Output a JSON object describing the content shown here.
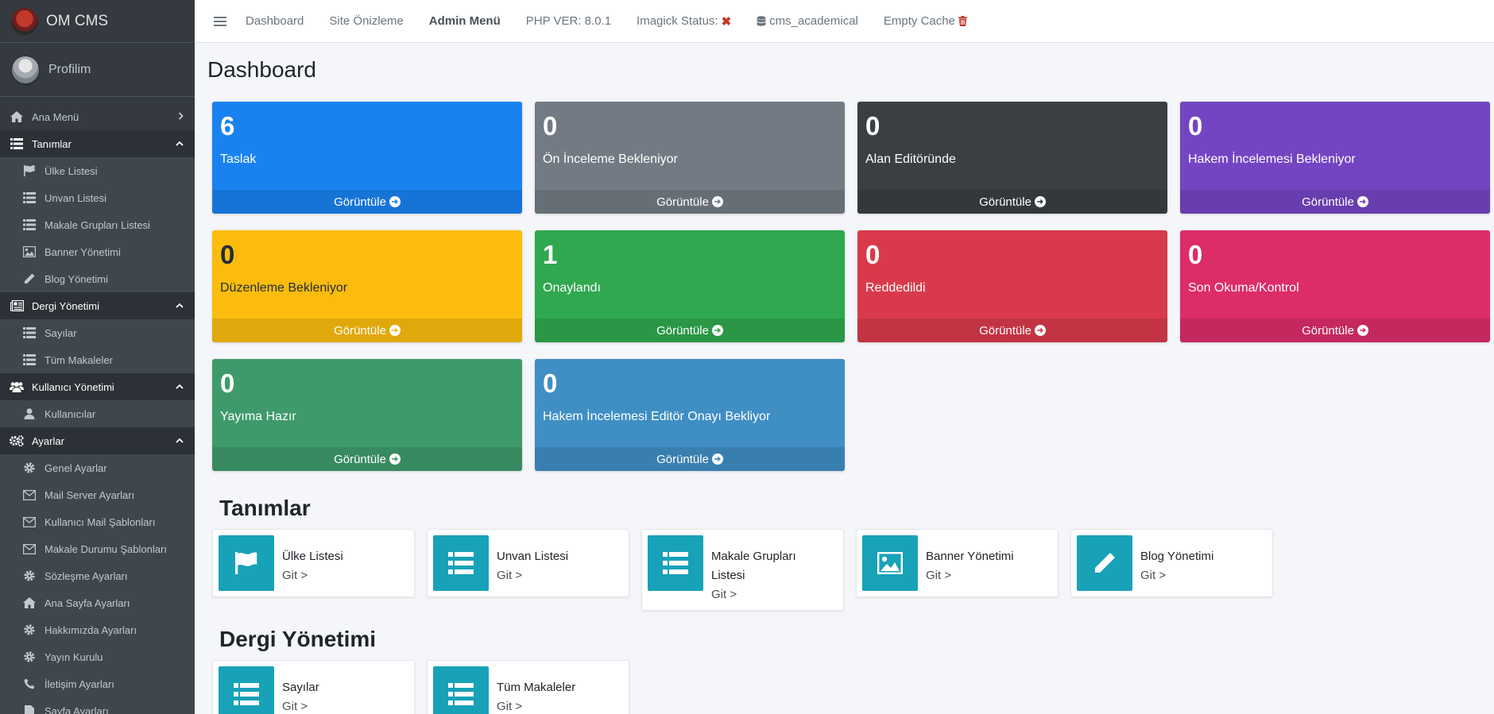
{
  "brand": {
    "name": "OM CMS"
  },
  "user": {
    "name": "Profilim"
  },
  "sidebar": {
    "items": [
      {
        "label": "Ana Menü",
        "icon": "home-icon",
        "type": "plain",
        "chevron": "›"
      },
      {
        "label": "Tanımlar",
        "icon": "list-icon",
        "type": "head",
        "chevron": "‹"
      },
      {
        "label": "Ülke Listesi",
        "icon": "flag-icon",
        "type": "sub"
      },
      {
        "label": "Unvan Listesi",
        "icon": "list-icon",
        "type": "sub"
      },
      {
        "label": "Makale Grupları Listesi",
        "icon": "list-icon",
        "type": "sub"
      },
      {
        "label": "Banner Yönetimi",
        "icon": "image-icon",
        "type": "sub"
      },
      {
        "label": "Blog Yönetimi",
        "icon": "pencil-icon",
        "type": "sub"
      },
      {
        "label": "Dergi Yönetimi",
        "icon": "newspaper-icon",
        "type": "head",
        "chevron": "‹"
      },
      {
        "label": "Sayılar",
        "icon": "list-icon",
        "type": "sub"
      },
      {
        "label": "Tüm Makaleler",
        "icon": "list-icon",
        "type": "sub"
      },
      {
        "label": "Kullanıcı Yönetimi",
        "icon": "users-icon",
        "type": "head",
        "chevron": "‹"
      },
      {
        "label": "Kullanıcılar",
        "icon": "user-icon",
        "type": "sub"
      },
      {
        "label": "Ayarlar",
        "icon": "gears-icon",
        "type": "head",
        "chevron": "‹"
      },
      {
        "label": "Genel Ayarlar",
        "icon": "gear-icon",
        "type": "sub"
      },
      {
        "label": "Mail Server Ayarları",
        "icon": "envelope-icon",
        "type": "sub"
      },
      {
        "label": "Kullanıcı Mail Şablonları",
        "icon": "envelope-icon",
        "type": "sub"
      },
      {
        "label": "Makale Durumu Şablonları",
        "icon": "envelope-icon",
        "type": "sub"
      },
      {
        "label": "Sözleşme Ayarları",
        "icon": "gear-icon",
        "type": "sub"
      },
      {
        "label": "Ana Sayfa Ayarları",
        "icon": "home-icon",
        "type": "sub"
      },
      {
        "label": "Hakkımızda Ayarları",
        "icon": "gear-icon",
        "type": "sub"
      },
      {
        "label": "Yayın Kurulu",
        "icon": "gear-icon",
        "type": "sub"
      },
      {
        "label": "İletişim Ayarları",
        "icon": "phone-icon",
        "type": "sub"
      },
      {
        "label": "Sayfa Ayarları",
        "icon": "file-icon",
        "type": "sub"
      }
    ]
  },
  "topbar": {
    "dashboard": "Dashboard",
    "preview": "Site Önizleme",
    "admin_menu": "Admin Menü",
    "php_ver": "PHP VER: 8.0.1",
    "imagick": "Imagick Status:",
    "imagick_mark": "✖",
    "db": "cms_academical",
    "cache": "Empty Cache"
  },
  "page": {
    "title": "Dashboard"
  },
  "stats": [
    {
      "value": "6",
      "label": "Taslak",
      "link": "Görüntüle",
      "color": "#1a82f0"
    },
    {
      "value": "0",
      "label": "Ön İnceleme Bekleniyor",
      "link": "Görüntüle",
      "color": "#727b84"
    },
    {
      "value": "0",
      "label": "Alan Editöründe",
      "link": "Görüntüle",
      "color": "#3a3f44"
    },
    {
      "value": "0",
      "label": "Hakem İncelemesi Bekleniyor",
      "link": "Görüntüle",
      "color": "#7445c2"
    },
    {
      "value": "0",
      "label": "Düzenleme Bekleniyor",
      "link": "Görüntüle",
      "color": "#fbbc0d",
      "dark": true
    },
    {
      "value": "1",
      "label": "Onaylandı",
      "link": "Görüntüle",
      "color": "#2fa84f"
    },
    {
      "value": "0",
      "label": "Reddedildi",
      "link": "Görüntüle",
      "color": "#d93a4b"
    },
    {
      "value": "0",
      "label": "Son Okuma/Kontrol",
      "link": "Görüntüle",
      "color": "#dc2c6a"
    },
    {
      "value": "0",
      "label": "Yayıma Hazır",
      "link": "Görüntüle",
      "color": "#3f9a6b"
    },
    {
      "value": "0",
      "label": "Hakem İncelemesi Editör Onayı Bekliyor",
      "link": "Görüntüle",
      "color": "#3f8ec4"
    }
  ],
  "sections": {
    "tanimlar": {
      "title": "Tanımlar",
      "cards": [
        {
          "title": "Ülke Listesi",
          "go": "Git >",
          "icon": "flag-icon"
        },
        {
          "title": "Unvan Listesi",
          "go": "Git >",
          "icon": "list-icon"
        },
        {
          "title": "Makale Grupları Listesi",
          "go": "Git >",
          "icon": "list-icon"
        },
        {
          "title": "Banner Yönetimi",
          "go": "Git >",
          "icon": "image-icon"
        },
        {
          "title": "Blog Yönetimi",
          "go": "Git >",
          "icon": "pencil-icon"
        }
      ]
    },
    "dergi": {
      "title": "Dergi Yönetimi",
      "cards": [
        {
          "title": "Sayılar",
          "go": "Git >",
          "icon": "list-icon"
        },
        {
          "title": "Tüm Makaleler",
          "go": "Git >",
          "icon": "list-icon"
        }
      ]
    }
  }
}
